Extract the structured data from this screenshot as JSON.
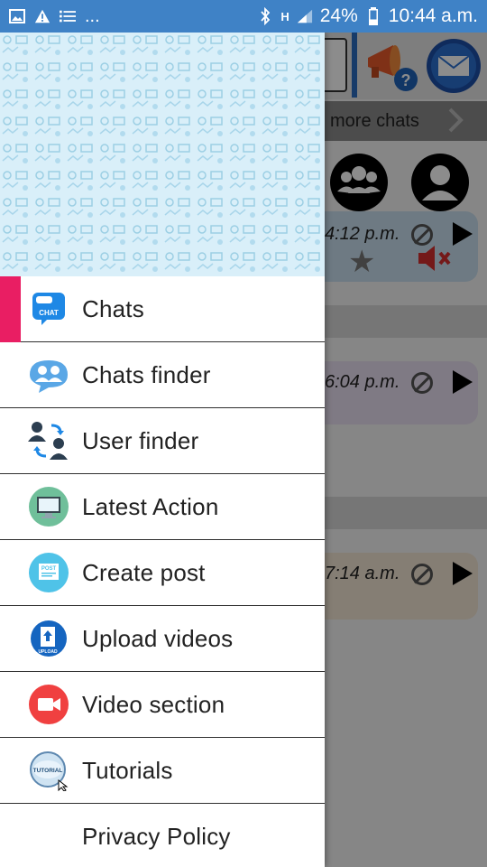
{
  "status_bar": {
    "battery": "24%",
    "time": "10:44 a.m.",
    "overflow": "...",
    "network_label": "H"
  },
  "background_app": {
    "more_chats_label": "more chats",
    "rows": [
      {
        "time": "4:12 p.m."
      },
      {
        "time": "6:04 p.m."
      },
      {
        "time": "7:14 a.m."
      }
    ]
  },
  "drawer": {
    "items": [
      {
        "label": "Chats",
        "icon": "chat-icon",
        "icon_text": "CHAT"
      },
      {
        "label": "Chats finder",
        "icon": "group-chat-icon"
      },
      {
        "label": "User finder",
        "icon": "user-swap-icon"
      },
      {
        "label": "Latest Action",
        "icon": "monitor-icon"
      },
      {
        "label": "Create post",
        "icon": "post-icon",
        "icon_text": "POST"
      },
      {
        "label": "Upload videos",
        "icon": "upload-icon",
        "icon_text": "UPLOAD"
      },
      {
        "label": "Video section",
        "icon": "video-camera-icon"
      },
      {
        "label": "Tutorials",
        "icon": "tutorial-icon",
        "icon_text": "TUTORIAL"
      },
      {
        "label": "Privacy Policy",
        "icon": ""
      }
    ]
  },
  "colors": {
    "status_bar": "#3f82c6",
    "active_marker": "#e91e63",
    "header_bg": "#d7eef8"
  }
}
